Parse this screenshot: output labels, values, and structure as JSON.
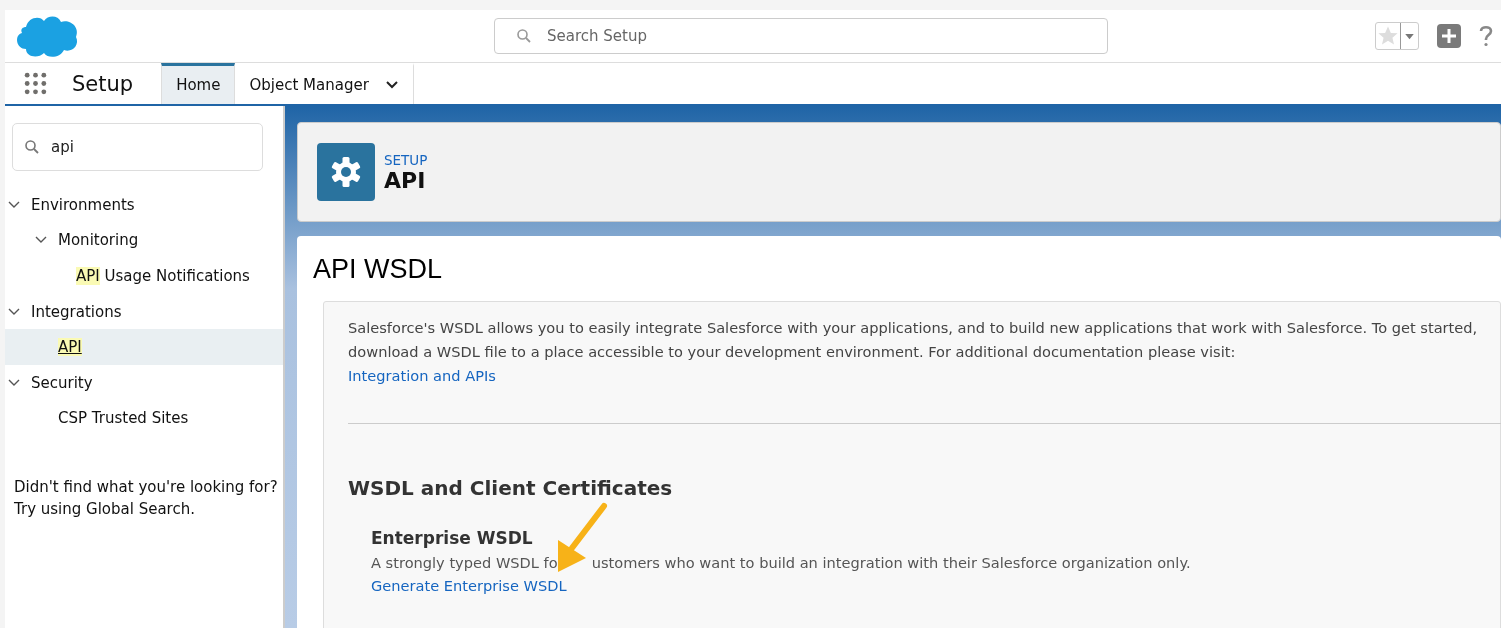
{
  "header": {
    "search": {
      "placeholder": "Search Setup"
    }
  },
  "nav": {
    "app_name": "Setup",
    "tabs": [
      {
        "label": "Home",
        "selected": true,
        "dropdown": false
      },
      {
        "label": "Object Manager",
        "selected": false,
        "dropdown": true
      }
    ]
  },
  "sidebar": {
    "search": {
      "value": "api"
    },
    "tree": [
      {
        "label": "Environments",
        "expanded": true,
        "selected": false,
        "children": [
          {
            "label": "Monitoring",
            "expanded": true,
            "selected": false,
            "children": [
              {
                "label": " Usage Notifications",
                "highlight": "API",
                "selected": false
              }
            ]
          }
        ]
      },
      {
        "label": "Integrations",
        "expanded": true,
        "selected": false,
        "children": [
          {
            "highlight": "API",
            "selected": true
          }
        ]
      },
      {
        "label": "Security",
        "expanded": true,
        "selected": false,
        "children": [
          {
            "label": "CSP Trusted Sites",
            "selected": false
          }
        ]
      }
    ],
    "help": [
      "Didn't find what you're looking for?",
      "Try using Global Search."
    ]
  },
  "page_header": {
    "breadcrumb": "SETUP",
    "title": "API"
  },
  "content": {
    "title": "API WSDL",
    "intro": "Salesforce's WSDL allows you to easily integrate Salesforce with your applications, and to build new applications that work with Salesforce. To get started, download a WSDL file to a place accessible to your development environment. For additional documentation please visit:",
    "intro_link": "Integration and APIs",
    "section_title": "WSDL and Client Certificates",
    "items": [
      {
        "title": "Enterprise WSDL",
        "description": [
          "A strongly typed WSDL fo",
          "ustomers who want to build an integration with their Salesforce organization only."
        ],
        "link": "Generate Enterprise WSDL"
      }
    ]
  }
}
